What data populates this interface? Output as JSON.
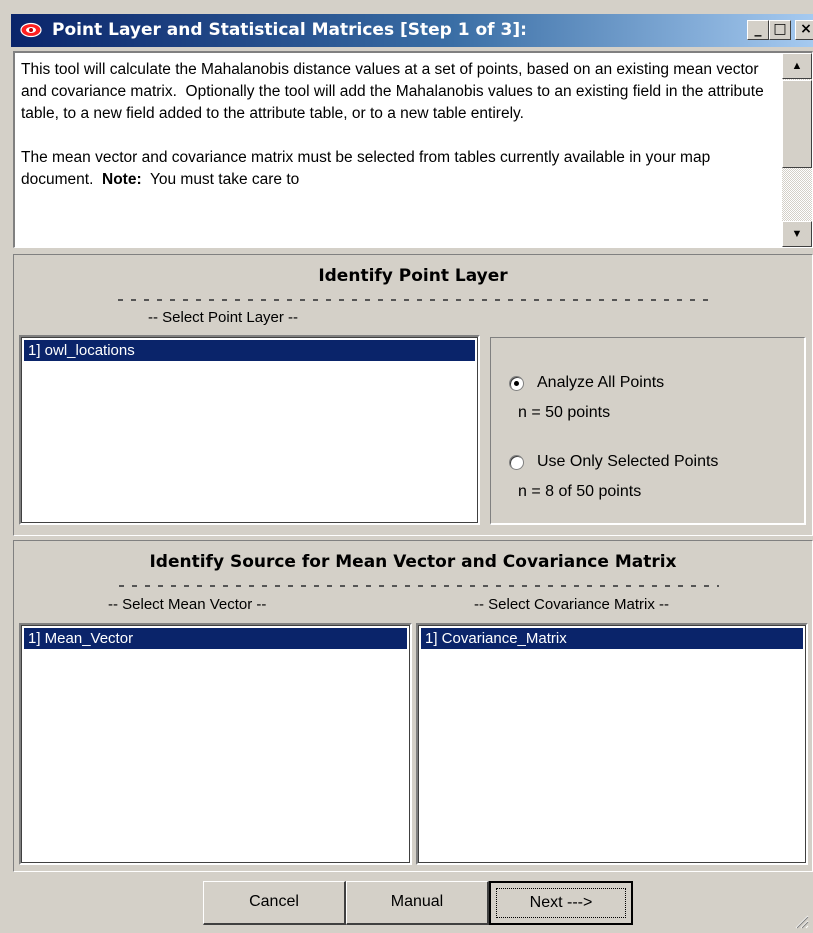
{
  "window": {
    "title": "Point Layer and Statistical Matrices [Step 1 of 3]:",
    "controls": {
      "minimize": "_",
      "maximize": "□",
      "close": "×"
    }
  },
  "description": {
    "para1": "This tool will calculate the Mahalanobis distance values at a set of points, based on an existing mean vector and covariance matrix.  Optionally the tool will add the Mahalanobis values to an existing field in the attribute table, to a new field added to the attribute table, or to a new table entirely.",
    "para2_start": "The mean vector and covariance matrix must be selected from tables currently available in your map document.  ",
    "para2_bold": "Note:",
    "para2_end": "  You must take care to"
  },
  "point_panel": {
    "title": "Identify Point Layer",
    "select_label": "-- Select Point Layer --",
    "items": [
      "1]  owl_locations"
    ],
    "options": {
      "all_label": "Analyze All Points",
      "all_count": "n = 50 points",
      "selected_label": "Use Only Selected Points",
      "selected_count": "n = 8 of 50 points",
      "selected_option": "all"
    }
  },
  "matrix_panel": {
    "title": "Identify Source for Mean Vector and Covariance Matrix",
    "mean_label": "-- Select Mean Vector --",
    "cov_label": "-- Select Covariance Matrix --",
    "mean_items": [
      "1]  Mean_Vector"
    ],
    "cov_items": [
      "1]  Covariance_Matrix"
    ]
  },
  "buttons": {
    "cancel": "Cancel",
    "manual": "Manual",
    "next": "Next --->"
  },
  "colors": {
    "selection": "#0a246a",
    "face": "#d4d0c8"
  }
}
